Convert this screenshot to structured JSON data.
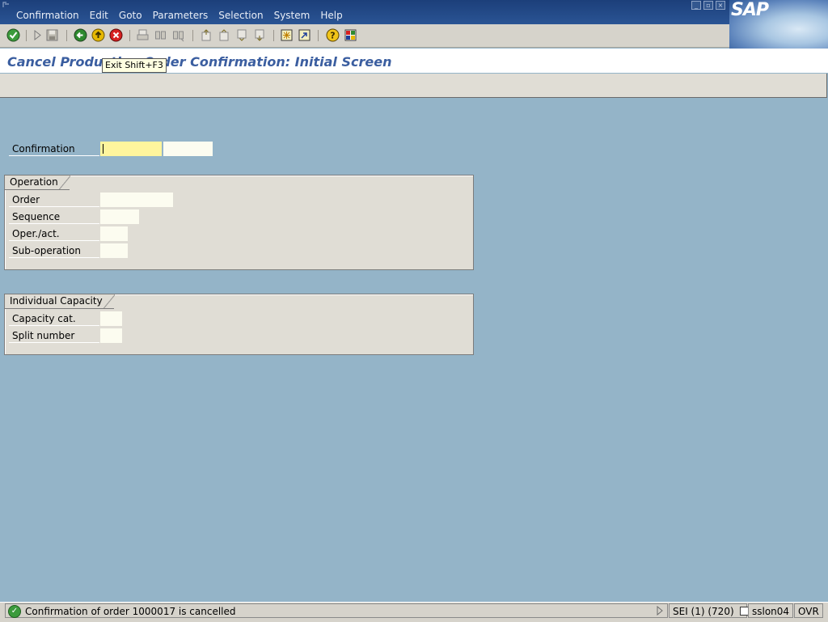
{
  "menubar": {
    "items": [
      "Confirmation",
      "Edit",
      "Goto",
      "Parameters",
      "Selection",
      "System",
      "Help"
    ],
    "logo": "SAP"
  },
  "toolbar": {
    "icons": [
      "enter-icon",
      "command-field-arrow-icon",
      "save-icon",
      "back-icon",
      "exit-icon",
      "cancel-icon",
      "print-icon",
      "find-icon",
      "find-next-icon",
      "first-page-icon",
      "previous-page-icon",
      "next-page-icon",
      "last-page-icon",
      "create-session-icon",
      "shortcut-icon",
      "help-icon",
      "layout-menu-icon"
    ]
  },
  "tooltip": {
    "text": "Exit  Shift+F3"
  },
  "title": "Cancel Production Order Confirmation: Initial Screen",
  "form": {
    "confirmation_label": "Confirmation",
    "confirmation_value": "",
    "operation": {
      "title": "Operation",
      "order_label": "Order",
      "sequence_label": "Sequence",
      "operact_label": "Oper./act.",
      "subop_label": "Sub-operation"
    },
    "capacity": {
      "title": "Individual Capacity",
      "capcat_label": "Capacity cat.",
      "split_label": "Split number"
    }
  },
  "statusbar": {
    "message": "Confirmation of order 1000017 is cancelled",
    "system": "SEI (1) (720)",
    "server": "sslon04",
    "mode": "OVR"
  },
  "colors": {
    "menubar": "#1c3f7a",
    "background": "#94b4c8",
    "title": "#3b5ea0",
    "required_field": "#fff59d",
    "field": "#fcfcf0",
    "group": "#e0ddd5"
  }
}
